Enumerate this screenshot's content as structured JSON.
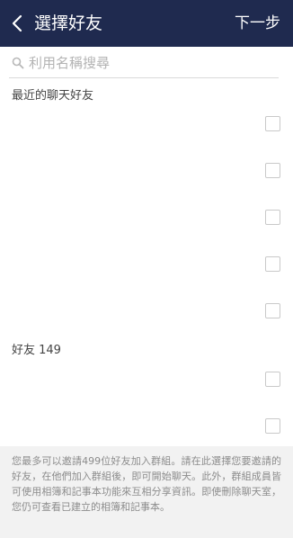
{
  "header": {
    "back_icon": "chevron-left-icon",
    "title": "選擇好友",
    "next_label": "下一步",
    "background": "#1f2a4f"
  },
  "search": {
    "icon": "search-icon",
    "placeholder": "利用名稱搜尋",
    "value": ""
  },
  "recent": {
    "title": "最近的聊天好友",
    "rows": [
      {
        "name": "",
        "checked": false
      },
      {
        "name": "",
        "checked": false
      },
      {
        "name": "",
        "checked": false
      },
      {
        "name": "",
        "checked": false
      },
      {
        "name": "",
        "checked": false
      }
    ]
  },
  "friends": {
    "title": "好友 149",
    "rows": [
      {
        "name": "",
        "checked": false
      },
      {
        "name": "",
        "checked": false
      }
    ]
  },
  "footer": {
    "note": "您最多可以邀請499位好友加入群組。請在此選擇您要邀請的好友，在他們加入群組後，即可開始聊天。此外，群組成員皆可使用相簿和記事本功能來互相分享資訊。即使刪除聊天室，您仍可查看已建立的相簿和記事本。"
  }
}
